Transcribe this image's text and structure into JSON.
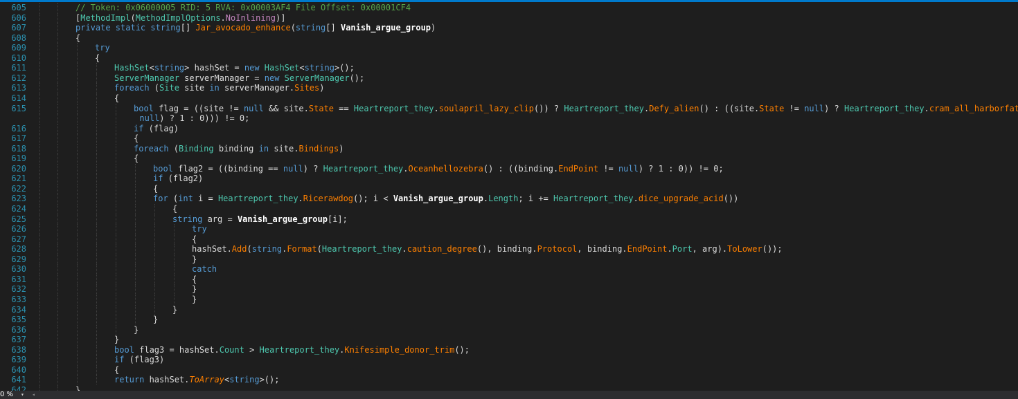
{
  "editor": {
    "lines": [
      {
        "num": "605",
        "tokens": [
          [
            "cmt",
            "// Token: 0x06000005 RID: 5 RVA: 0x00003AF4 File Offset: 0x00001CF4"
          ]
        ]
      },
      {
        "num": "606",
        "tokens": [
          [
            "plain",
            "["
          ],
          [
            "type",
            "MethodImpl"
          ],
          [
            "plain",
            "("
          ],
          [
            "type",
            "MethodImplOptions"
          ],
          [
            "plain",
            "."
          ],
          [
            "attr",
            "NoInlining"
          ],
          [
            "plain",
            ")]"
          ]
        ]
      },
      {
        "num": "607",
        "tokens": [
          [
            "kw",
            "private static string"
          ],
          [
            "plain",
            "[] "
          ],
          [
            "meth",
            "Jar_avocado_enhance"
          ],
          [
            "plain",
            "("
          ],
          [
            "kw",
            "string"
          ],
          [
            "plain",
            "[] "
          ],
          [
            "bold",
            "Vanish_argue_group"
          ],
          [
            "plain",
            ")"
          ]
        ]
      },
      {
        "num": "608",
        "tokens": [
          [
            "plain",
            "{"
          ]
        ]
      },
      {
        "num": "609",
        "tokens": [
          [
            "kw",
            "try"
          ]
        ]
      },
      {
        "num": "610",
        "tokens": [
          [
            "plain",
            "{"
          ]
        ]
      },
      {
        "num": "611",
        "tokens": [
          [
            "type",
            "HashSet"
          ],
          [
            "plain",
            "<"
          ],
          [
            "kw",
            "string"
          ],
          [
            "plain",
            "> hashSet = "
          ],
          [
            "kw",
            "new "
          ],
          [
            "type",
            "HashSet"
          ],
          [
            "plain",
            "<"
          ],
          [
            "kw",
            "string"
          ],
          [
            "plain",
            ">();"
          ]
        ]
      },
      {
        "num": "612",
        "tokens": [
          [
            "type",
            "ServerManager"
          ],
          [
            "plain",
            " serverManager = "
          ],
          [
            "kw",
            "new "
          ],
          [
            "type",
            "ServerManager"
          ],
          [
            "plain",
            "();"
          ]
        ]
      },
      {
        "num": "613",
        "tokens": [
          [
            "kw",
            "foreach"
          ],
          [
            "plain",
            " ("
          ],
          [
            "type",
            "Site"
          ],
          [
            "plain",
            " site "
          ],
          [
            "kw",
            "in"
          ],
          [
            "plain",
            " serverManager."
          ],
          [
            "meth",
            "Sites"
          ],
          [
            "plain",
            ")"
          ]
        ]
      },
      {
        "num": "614",
        "tokens": [
          [
            "plain",
            "{"
          ]
        ]
      },
      {
        "num": "615",
        "tokens": [
          [
            "kw",
            "bool"
          ],
          [
            "plain",
            " flag = ((site != "
          ],
          [
            "kw",
            "null"
          ],
          [
            "plain",
            " && site."
          ],
          [
            "meth",
            "State"
          ],
          [
            "plain",
            " == "
          ],
          [
            "type",
            "Heartreport_they"
          ],
          [
            "plain",
            "."
          ],
          [
            "meth",
            "soulapril_lazy_clip"
          ],
          [
            "plain",
            "()) ? "
          ],
          [
            "type",
            "Heartreport_they"
          ],
          [
            "plain",
            "."
          ],
          [
            "meth",
            "Defy_alien"
          ],
          [
            "plain",
            "() : ((site."
          ],
          [
            "meth",
            "State"
          ],
          [
            "plain",
            " != "
          ],
          [
            "kw",
            "null"
          ],
          [
            "plain",
            ") ? "
          ],
          [
            "type",
            "Heartreport_they"
          ],
          [
            "plain",
            "."
          ],
          [
            "meth",
            "cram_all_harborfatal"
          ],
          [
            "plain",
            "() :"
          ]
        ]
      },
      {
        "num": "",
        "tokens": [
          [
            "kw",
            "null"
          ],
          [
            "plain",
            ") ? 1 : 0))) != 0;"
          ]
        ]
      },
      {
        "num": "616",
        "tokens": [
          [
            "kw",
            "if"
          ],
          [
            "plain",
            " (flag)"
          ]
        ]
      },
      {
        "num": "617",
        "tokens": [
          [
            "plain",
            "{"
          ]
        ]
      },
      {
        "num": "618",
        "tokens": [
          [
            "kw",
            "foreach"
          ],
          [
            "plain",
            " ("
          ],
          [
            "type",
            "Binding"
          ],
          [
            "plain",
            " binding "
          ],
          [
            "kw",
            "in"
          ],
          [
            "plain",
            " site."
          ],
          [
            "meth",
            "Bindings"
          ],
          [
            "plain",
            ")"
          ]
        ]
      },
      {
        "num": "619",
        "tokens": [
          [
            "plain",
            "{"
          ]
        ]
      },
      {
        "num": "620",
        "tokens": [
          [
            "kw",
            "bool"
          ],
          [
            "plain",
            " flag2 = ((binding == "
          ],
          [
            "kw",
            "null"
          ],
          [
            "plain",
            ") ? "
          ],
          [
            "type",
            "Heartreport_they"
          ],
          [
            "plain",
            "."
          ],
          [
            "meth",
            "Oceanhellozebra"
          ],
          [
            "plain",
            "() : ((binding."
          ],
          [
            "meth",
            "EndPoint"
          ],
          [
            "plain",
            " != "
          ],
          [
            "kw",
            "null"
          ],
          [
            "plain",
            ") ? 1 : 0)) != 0;"
          ]
        ]
      },
      {
        "num": "621",
        "tokens": [
          [
            "kw",
            "if"
          ],
          [
            "plain",
            " (flag2)"
          ]
        ]
      },
      {
        "num": "622",
        "tokens": [
          [
            "plain",
            "{"
          ]
        ]
      },
      {
        "num": "623",
        "tokens": [
          [
            "kw",
            "for"
          ],
          [
            "plain",
            " ("
          ],
          [
            "kw",
            "int"
          ],
          [
            "plain",
            " i = "
          ],
          [
            "type",
            "Heartreport_they"
          ],
          [
            "plain",
            "."
          ],
          [
            "meth",
            "Ricerawdog"
          ],
          [
            "plain",
            "(); i < "
          ],
          [
            "bold",
            "Vanish_argue_group"
          ],
          [
            "plain",
            "."
          ],
          [
            "prop",
            "Length"
          ],
          [
            "plain",
            "; i += "
          ],
          [
            "type",
            "Heartreport_they"
          ],
          [
            "plain",
            "."
          ],
          [
            "meth",
            "dice_upgrade_acid"
          ],
          [
            "plain",
            "())"
          ]
        ]
      },
      {
        "num": "624",
        "tokens": [
          [
            "plain",
            "{"
          ]
        ]
      },
      {
        "num": "625",
        "tokens": [
          [
            "kw",
            "string"
          ],
          [
            "plain",
            " arg = "
          ],
          [
            "bold",
            "Vanish_argue_group"
          ],
          [
            "plain",
            "[i];"
          ]
        ]
      },
      {
        "num": "626",
        "tokens": [
          [
            "kw",
            "try"
          ]
        ]
      },
      {
        "num": "627",
        "tokens": [
          [
            "plain",
            "{"
          ]
        ]
      },
      {
        "num": "628",
        "tokens": [
          [
            "plain",
            "hashSet."
          ],
          [
            "meth",
            "Add"
          ],
          [
            "plain",
            "("
          ],
          [
            "kw",
            "string"
          ],
          [
            "plain",
            "."
          ],
          [
            "meth",
            "Format"
          ],
          [
            "plain",
            "("
          ],
          [
            "type",
            "Heartreport_they"
          ],
          [
            "plain",
            "."
          ],
          [
            "meth",
            "caution_degree"
          ],
          [
            "plain",
            "(), binding."
          ],
          [
            "meth",
            "Protocol"
          ],
          [
            "plain",
            ", binding."
          ],
          [
            "meth",
            "EndPoint"
          ],
          [
            "plain",
            "."
          ],
          [
            "prop",
            "Port"
          ],
          [
            "plain",
            ", arg)."
          ],
          [
            "meth",
            "ToLower"
          ],
          [
            "plain",
            "());"
          ]
        ]
      },
      {
        "num": "629",
        "tokens": [
          [
            "plain",
            "}"
          ]
        ]
      },
      {
        "num": "630",
        "tokens": [
          [
            "kw",
            "catch"
          ]
        ]
      },
      {
        "num": "631",
        "tokens": [
          [
            "plain",
            "{"
          ]
        ]
      },
      {
        "num": "632",
        "tokens": [
          [
            "plain",
            "}"
          ]
        ]
      },
      {
        "num": "633",
        "tokens": [
          [
            "plain",
            "}"
          ]
        ]
      },
      {
        "num": "634",
        "tokens": [
          [
            "plain",
            "}"
          ]
        ]
      },
      {
        "num": "635",
        "tokens": [
          [
            "plain",
            "}"
          ]
        ]
      },
      {
        "num": "636",
        "tokens": [
          [
            "plain",
            "}"
          ]
        ]
      },
      {
        "num": "637",
        "tokens": [
          [
            "plain",
            "}"
          ]
        ]
      },
      {
        "num": "638",
        "tokens": [
          [
            "kw",
            "bool"
          ],
          [
            "plain",
            " flag3 = hashSet."
          ],
          [
            "prop",
            "Count"
          ],
          [
            "plain",
            " > "
          ],
          [
            "type",
            "Heartreport_they"
          ],
          [
            "plain",
            "."
          ],
          [
            "meth",
            "Knifesimple_donor_trim"
          ],
          [
            "plain",
            "();"
          ]
        ]
      },
      {
        "num": "639",
        "tokens": [
          [
            "kw",
            "if"
          ],
          [
            "plain",
            " (flag3)"
          ]
        ]
      },
      {
        "num": "640",
        "tokens": [
          [
            "plain",
            "{"
          ]
        ]
      },
      {
        "num": "641",
        "tokens": [
          [
            "kw",
            "return"
          ],
          [
            "plain",
            " hashSet."
          ],
          [
            "ital",
            "ToArray"
          ],
          [
            "plain",
            "<"
          ],
          [
            "kw",
            "string"
          ],
          [
            "plain",
            ">();"
          ]
        ]
      },
      {
        "num": "642",
        "tokens": [
          [
            "plain",
            "}"
          ]
        ]
      }
    ]
  },
  "statusbar": {
    "zoom": "0 %",
    "zoom_dropdown_icon": "chevron-down-icon",
    "scroll_left_icon": "scroll-left-icon"
  },
  "colors": {
    "background": "#1e1e1e",
    "accent": "#007acc",
    "line_number": "#2b91af",
    "keyword": "#569cd6",
    "type": "#4ec9b0",
    "comment": "#57a64a",
    "method": "#ff8000"
  }
}
